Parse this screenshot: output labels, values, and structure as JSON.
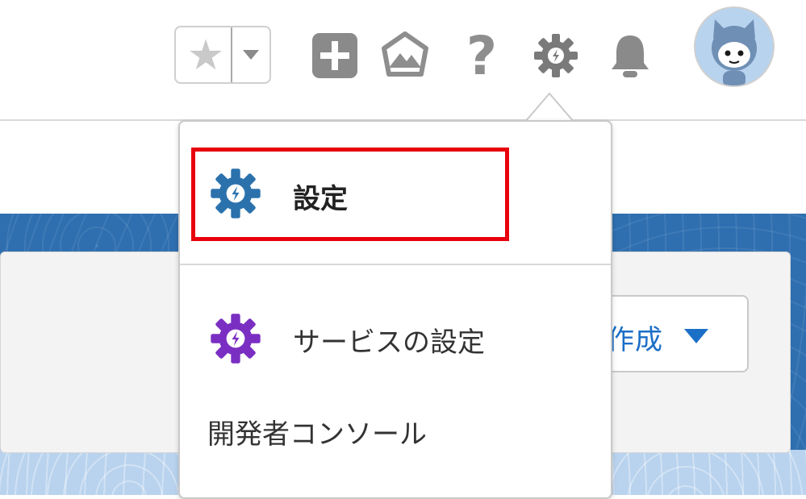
{
  "header": {
    "favorites_star": "★",
    "help_glyph": "?"
  },
  "background": {
    "create_button_label": "作成"
  },
  "setup_menu": {
    "items": [
      {
        "label": "設定",
        "icon": "setup-gear-icon",
        "icon_color": "#2b72ad"
      },
      {
        "label": "サービスの設定",
        "icon": "service-setup-gear-icon",
        "icon_color": "#7a2fc2"
      },
      {
        "label": "開発者コンソール",
        "icon": ""
      }
    ]
  },
  "colors": {
    "highlight": "#e8000c",
    "accent_blue": "#1b6fc7"
  }
}
